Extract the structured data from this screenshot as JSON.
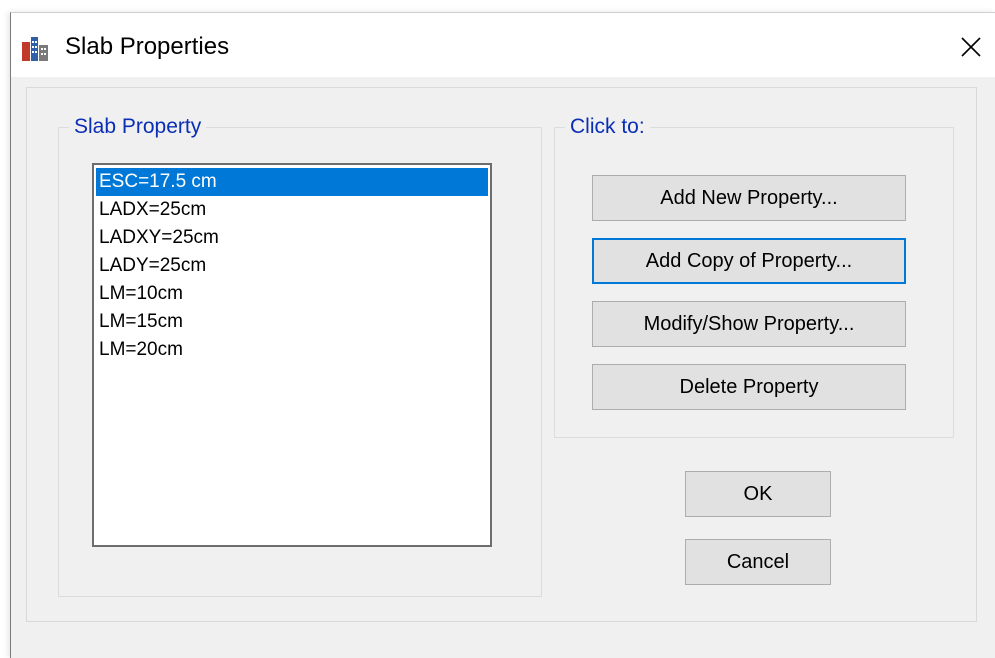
{
  "window": {
    "title": "Slab Properties",
    "icon": "etabs-app-icon",
    "close_icon": "close-icon"
  },
  "slab_property": {
    "legend": "Slab Property",
    "items": [
      "ESC=17.5 cm",
      "LADX=25cm",
      "LADXY=25cm",
      "LADY=25cm",
      "LM=10cm",
      "LM=15cm",
      "LM=20cm"
    ],
    "selected": "ESC=17.5 cm"
  },
  "click_to": {
    "legend": "Click to:",
    "add_new": "Add New Property...",
    "add_copy": "Add Copy of Property...",
    "modify_show": "Modify/Show Property...",
    "delete": "Delete Property"
  },
  "buttons": {
    "ok": "OK",
    "cancel": "Cancel"
  },
  "colors": {
    "selection": "#0078d7",
    "group_label": "#0a2fb5",
    "button_face": "#e1e1e1"
  }
}
